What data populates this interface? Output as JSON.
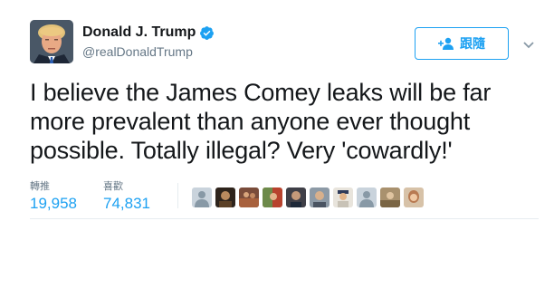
{
  "tweet": {
    "author": {
      "display_name": "Donald J. Trump",
      "handle": "@realDonaldTrump",
      "verified": true,
      "avatar_icon": "profile-photo"
    },
    "follow_button": {
      "label": "跟隨",
      "icon": "add-user-icon"
    },
    "text_lines": [
      "I believe the James Comey leaks will be far",
      "more prevalent than anyone ever thought",
      "possible. Totally illegal? Very 'cowardly!'"
    ],
    "stats": {
      "retweets_label": "轉推",
      "retweets_value": "19,958",
      "likes_label": "喜歡",
      "likes_value": "74,831"
    },
    "liker_avatar_count": 10
  },
  "colors": {
    "accent": "#1da1f2",
    "text": "#14171a",
    "muted": "#657786",
    "border": "#e6ecf0"
  }
}
